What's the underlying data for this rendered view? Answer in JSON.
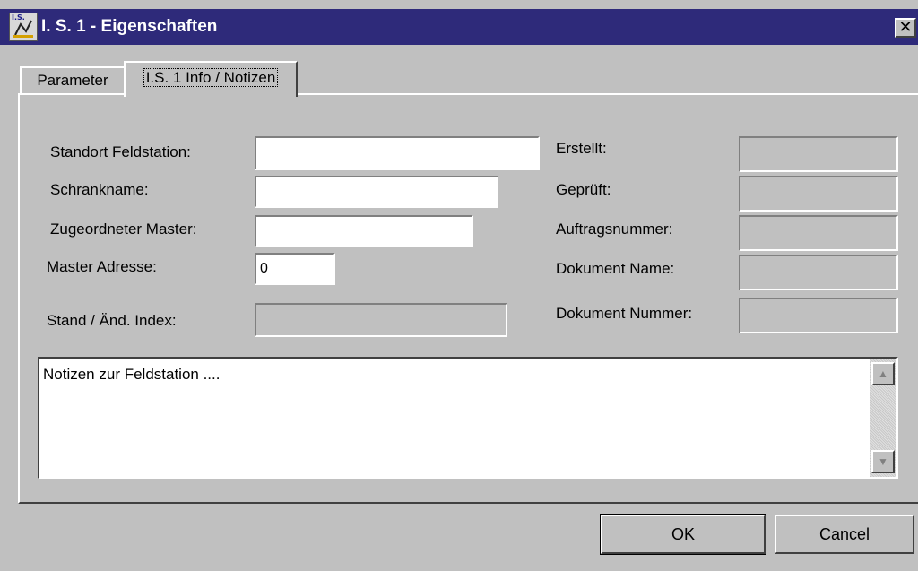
{
  "window": {
    "title": "I. S. 1 - Eigenschaften",
    "icon_text": "I.S.",
    "close_symbol": "✕"
  },
  "tabs": [
    {
      "label": "Parameter",
      "active": false
    },
    {
      "label": "I.S. 1 Info / Notizen",
      "active": true
    }
  ],
  "form": {
    "standort_label": "Standort Feldstation:",
    "standort_value": "",
    "schrank_label": "Schrankname:",
    "schrank_value": "",
    "master_label": "Zugeordneter Master:",
    "master_value": "",
    "adresse_label": "Master Adresse:",
    "adresse_value": "0",
    "stand_label": "Stand / Änd. Index:",
    "stand_value": ""
  },
  "info": {
    "erstellt_label": "Erstellt:",
    "geprueft_label": "Geprüft:",
    "auftrag_label": "Auftragsnummer:",
    "dokname_label": "Dokument Name:",
    "doknummer_label": "Dokument Nummer:"
  },
  "notes": {
    "text": "Notizen zur Feldstation ...."
  },
  "buttons": {
    "ok": "OK",
    "cancel": "Cancel"
  },
  "icons": {
    "app": "app-icon",
    "close": "close-icon",
    "scroll_up": "arrow-up-icon",
    "scroll_down": "arrow-down-icon"
  },
  "colors": {
    "titlebar": "#2e2a7a",
    "face": "#c0c0c0"
  }
}
